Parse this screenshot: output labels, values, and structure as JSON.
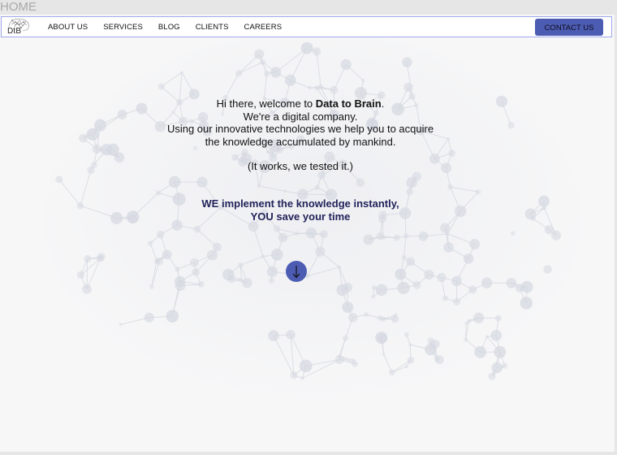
{
  "page_label": "HOME",
  "logo": {
    "text": "DtB"
  },
  "nav": {
    "items": [
      {
        "label": "ABOUT US"
      },
      {
        "label": "SERVICES"
      },
      {
        "label": "BLOG"
      },
      {
        "label": "CLIENTS"
      },
      {
        "label": "CAREERS"
      }
    ],
    "contact_label": "CONTACT US"
  },
  "hero": {
    "greeting_prefix": "Hi there, welcome to ",
    "brand": "Data to Brain",
    "greeting_suffix": ".",
    "line2": "We're a digital company.",
    "line3": "Using our innovative  technologies we help you to acquire",
    "line4": "the knowledge accumulated by mankind.",
    "line5": "(It works, we tested it.)",
    "tagline1": "WE implement the knowledge instantly,",
    "tagline2": "YOU save your time"
  },
  "colors": {
    "accent": "#4d5cb3",
    "navbar_border": "#9fa8ea",
    "tagline": "#22235a",
    "background": "#f7f7f8"
  },
  "icons": {
    "scroll": "arrow-down-icon"
  }
}
